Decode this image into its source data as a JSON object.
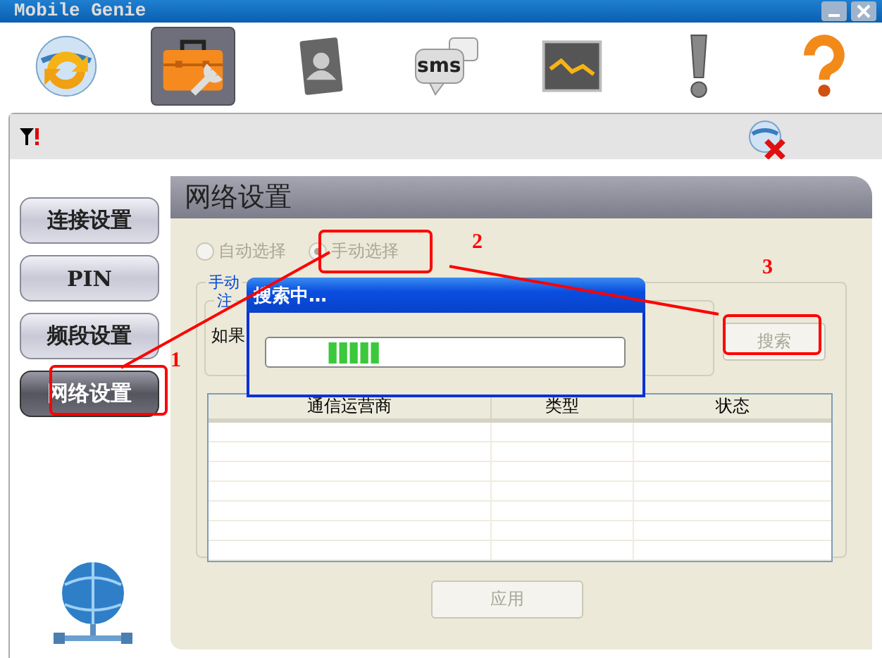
{
  "window": {
    "title": "Mobile Genie"
  },
  "toolbar": [
    {
      "kind": "sync",
      "selected": false
    },
    {
      "kind": "toolbox",
      "selected": true
    },
    {
      "kind": "contacts",
      "selected": false
    },
    {
      "kind": "sms",
      "label": "sms",
      "selected": false
    },
    {
      "kind": "chart",
      "selected": false
    },
    {
      "kind": "alert",
      "selected": false
    },
    {
      "kind": "help",
      "selected": false
    }
  ],
  "sidebar": {
    "items": [
      {
        "label": "连接设置",
        "selected": false
      },
      {
        "label": "PIN",
        "selected": false
      },
      {
        "label": "频段设置",
        "selected": false
      },
      {
        "label": "网络设置",
        "selected": true
      }
    ]
  },
  "panel": {
    "title": "网络设置",
    "radios": [
      {
        "label": "自动选择",
        "selected": false,
        "disabled": true
      },
      {
        "label": "手动选择",
        "selected": true,
        "disabled": true
      }
    ],
    "group": {
      "legend": "手动",
      "inner_legend": "注",
      "text": "如果"
    },
    "search_button": {
      "label": "搜索",
      "disabled": true
    },
    "table": {
      "columns": [
        "通信运营商",
        "类型",
        "状态"
      ]
    },
    "apply_button": {
      "label": "应用",
      "disabled": true
    }
  },
  "dialog": {
    "title": "搜索中…"
  },
  "annotations": [
    {
      "label": "1"
    },
    {
      "label": "2"
    },
    {
      "label": "3"
    }
  ]
}
